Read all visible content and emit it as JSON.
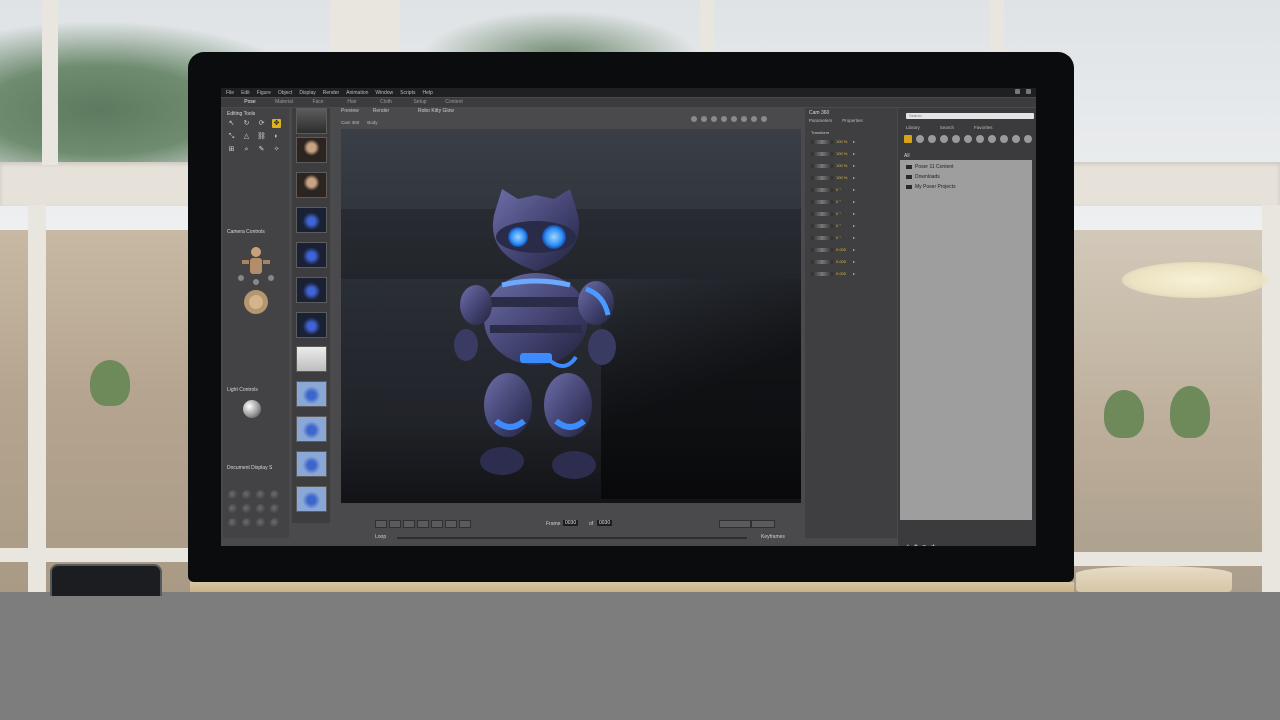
{
  "menu": [
    "File",
    "Edit",
    "Figure",
    "Object",
    "Display",
    "Render",
    "Animation",
    "Window",
    "Scripts",
    "Help"
  ],
  "rooms": [
    "Pose",
    "Material",
    "Face",
    "Hair",
    "Cloth",
    "Setup",
    "Content"
  ],
  "left_panel": {
    "editing_tools": "Editing Tools",
    "camera_controls": "Camera Controls",
    "light_controls": "Light Controls",
    "document_display": "Document Display S"
  },
  "viewport": {
    "tabs": [
      "Preview",
      "Render"
    ],
    "title": "Robo Kitty Glow",
    "camera": "Cam 360",
    "figure": "Body"
  },
  "transport": {
    "frame_label": "Frame",
    "frame_value": "0030",
    "of_label": "of",
    "frame_total": "0030",
    "loop_label": "Loop",
    "keyframes_label": "Keyframes"
  },
  "parameters": {
    "title": "Cam 360",
    "tabs": [
      "Parameters",
      "Properties"
    ],
    "group": "Transform",
    "values": [
      "100 %",
      "100 %",
      "100 %",
      "100 %",
      "0 °",
      "0 °",
      "0 °",
      "0 °",
      "0 °",
      "0.000",
      "0.000",
      "0.000"
    ]
  },
  "library": {
    "search_placeholder": "Search",
    "tabs": [
      "Library",
      "Search",
      "Favorites"
    ],
    "root": "All",
    "items": [
      "Poser 11 Content",
      "Downloads",
      "My Poser Projects"
    ]
  },
  "colors": {
    "accent": "#e2b21a",
    "panel": "#434345",
    "viewport_bg": "#2a2e35",
    "robot_glow": "#3aa0ff"
  }
}
